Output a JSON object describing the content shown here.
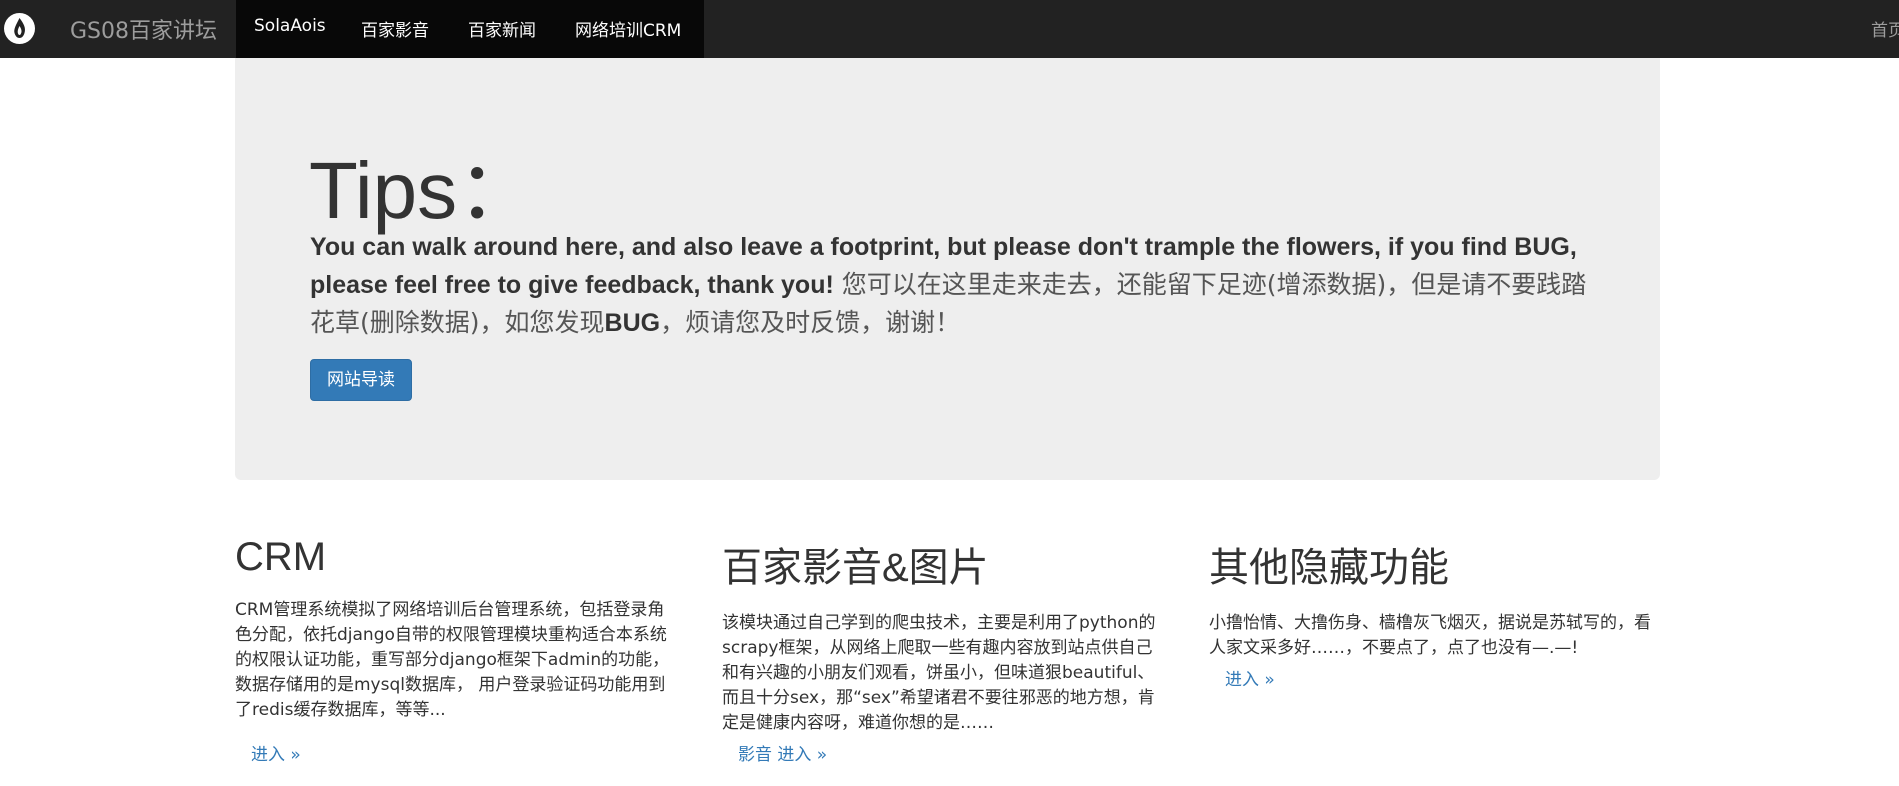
{
  "navbar": {
    "logo_icon": "flame-logo-icon",
    "brand": "GS08百家讲坛",
    "links": [
      "SolaAois",
      "百家影音",
      "百家新闻",
      "网络培训CRM"
    ],
    "right_link": "首页"
  },
  "jumbotron": {
    "title": "Tips：",
    "text_en": "You can walk around here, and also leave a footprint, but please don't trample the flowers, if you find BUG, please feel free to give feedback, thank you!",
    "text_zh_1": " 您可以在这里走来走去，还能留下足迹(增添数据)，但是请不要践踏花草(删除数据)，如您发现",
    "text_bug": "BUG",
    "text_zh_2": "，烦请您及时反馈，谢谢！",
    "button_label": "网站导读"
  },
  "columns": [
    {
      "title": "CRM",
      "body": "CRM管理系统模拟了网络培训后台管理系统，包括登录角色分配，依托django自带的权限管理模块重构适合本系统的权限认证功能，重写部分django框架下admin的功能，数据存储用的是mysql数据库， 用户登录验证码功能用到了redis缓存数据库，等等...",
      "link": "进入 »"
    },
    {
      "title": "百家影音&图片",
      "body": "该模块通过自己学到的爬虫技术，主要是利用了python的scrapy框架，从网络上爬取一些有趣内容放到站点供自己和有兴趣的小朋友们观看，饼虽小，但味道狠beautiful、而且十分sex，那“sex”希望诸君不要往邪恶的地方想，肯定是健康内容呀，难道你想的是……",
      "link": "影音 进入 »"
    },
    {
      "title": "其他隐藏功能",
      "body": "小撸怡情、大撸伤身、樯橹灰飞烟灭，据说是苏轼写的，看人家文采多好……，不要点了，点了也没有—.—!",
      "link": "进入 »"
    }
  ]
}
